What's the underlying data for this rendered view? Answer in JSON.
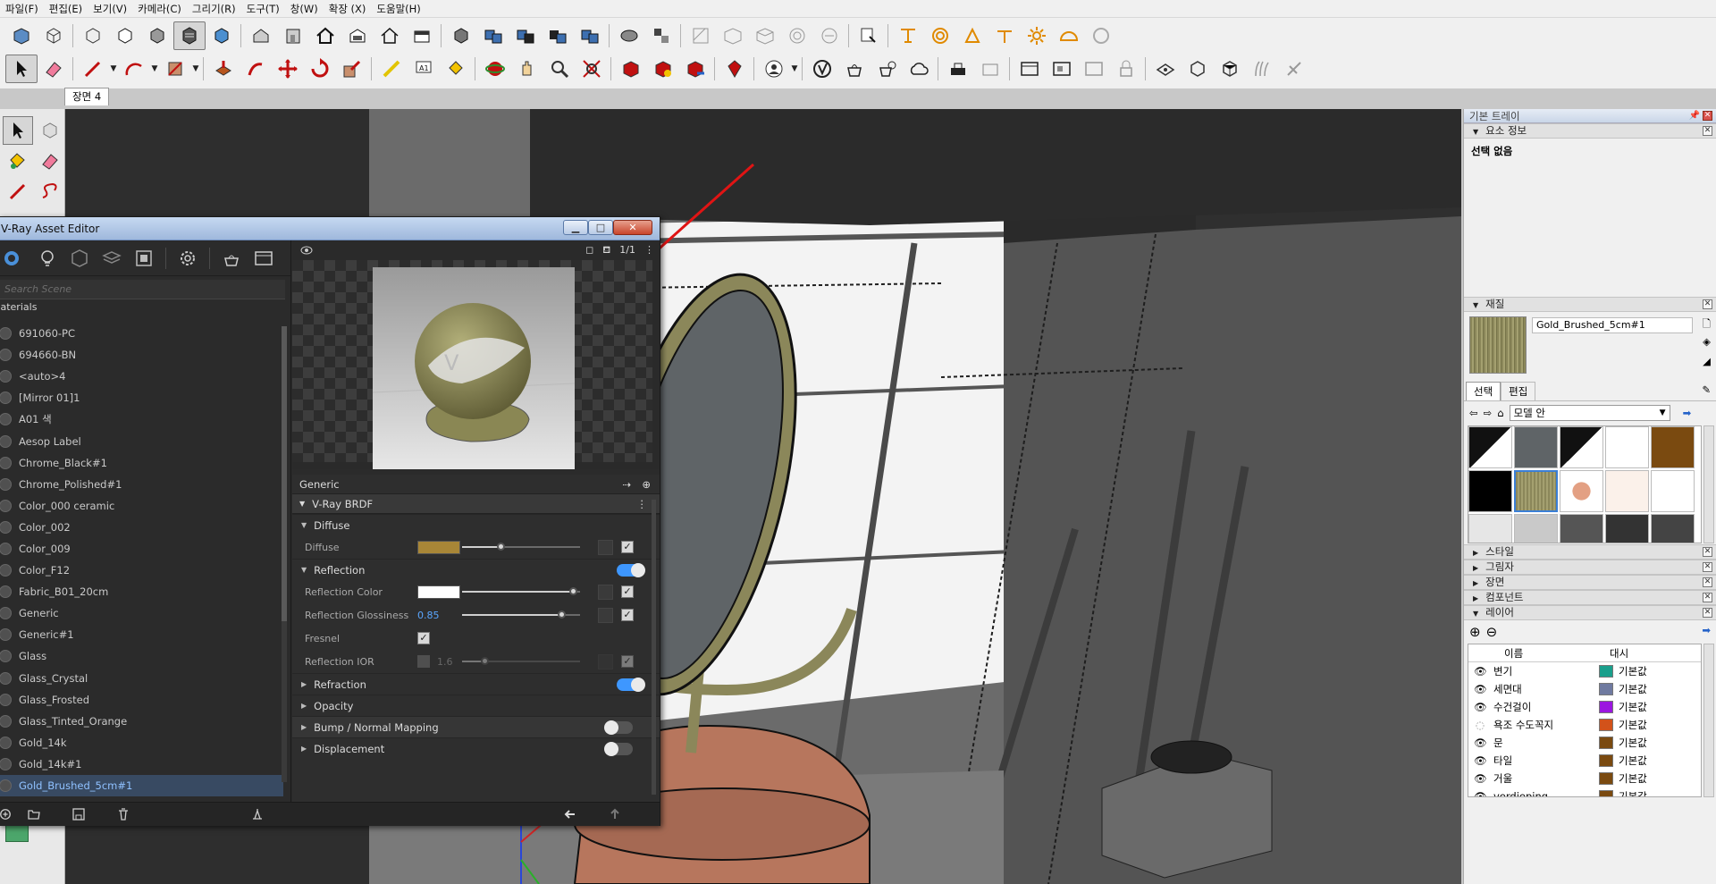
{
  "menubar": {
    "items": [
      "파일(F)",
      "편집(E)",
      "보기(V)",
      "카메라(C)",
      "그리기(R)",
      "도구(T)",
      "창(W)",
      "확장 (X)",
      "도움말(H)"
    ]
  },
  "scene_tabs": [
    "장면 4"
  ],
  "vray_editor": {
    "title": "V-Ray Asset Editor",
    "search_placeholder": "Search Scene",
    "materials_header": "Materials",
    "materials": [
      "691060-PC",
      "694660-BN",
      "<auto>4",
      "[Mirror 01]1",
      "A01 색",
      "Aesop Label",
      "Chrome_Black#1",
      "Chrome_Polished#1",
      "Color_000 ceramic",
      "Color_002",
      "Color_009",
      "Color_F12",
      "Fabric_B01_20cm",
      "Generic",
      "Generic#1",
      "Glass",
      "Glass_Crystal",
      "Glass_Frosted",
      "Glass_Tinted_Orange",
      "Gold_14k",
      "Gold_14k#1",
      "Gold_Brushed_5cm#1"
    ],
    "selected_material": "Gold_Brushed_5cm#1",
    "preview_page": "1/1",
    "props": {
      "generic_label": "Generic",
      "brdf_label": "V-Ray BRDF",
      "diffuse_section": "Diffuse",
      "diffuse_label": "Diffuse",
      "diffuse_color": "#a88637",
      "reflection_section": "Reflection",
      "reflection_color_label": "Reflection Color",
      "reflection_color": "#ffffff",
      "reflection_glossiness_label": "Reflection Glossiness",
      "reflection_glossiness_value": "0.85",
      "fresnel_label": "Fresnel",
      "reflection_ior_label": "Reflection IOR",
      "reflection_ior_value": "1.6",
      "refraction_section": "Refraction",
      "opacity_section": "Opacity",
      "bump_section": "Bump / Normal Mapping",
      "displacement_section": "Displacement"
    },
    "slider_values": {
      "diffuse": 0.33,
      "reflection_color": 0.95,
      "reflection_glossiness": 0.85,
      "reflection_ior": 0.2
    }
  },
  "tray": {
    "title": "기본 트레이",
    "entity_info": {
      "header": "요소 정보",
      "selection": "선택 없음"
    },
    "materials": {
      "header": "재질",
      "current_name": "Gold_Brushed_5cm#1",
      "tab_select": "선택",
      "tab_edit": "편집",
      "library": "모델 안"
    },
    "collapsed_panels": [
      "스타일",
      "그림자",
      "장면",
      "컴포넌트"
    ],
    "layers": {
      "header": "레이어",
      "col_name": "이름",
      "col_dash": "대시",
      "rows": [
        {
          "name": "변기",
          "color": "#1a9f8c",
          "dash": "기본값",
          "visible": true
        },
        {
          "name": "세면대",
          "color": "#6f7aa0",
          "dash": "기본값",
          "visible": true
        },
        {
          "name": "수건걸이",
          "color": "#9b16e0",
          "dash": "기본값",
          "visible": true
        },
        {
          "name": "욕조 수도꼭지",
          "color": "#d2521a",
          "dash": "기본값",
          "visible": false
        },
        {
          "name": "문",
          "color": "#7a4a10",
          "dash": "기본값",
          "visible": true
        },
        {
          "name": "타일",
          "color": "#7a4a10",
          "dash": "기본값",
          "visible": true
        },
        {
          "name": "거울",
          "color": "#7a4a10",
          "dash": "기본값",
          "visible": true
        },
        {
          "name": "verdieping",
          "color": "#7a4a10",
          "dash": "기본값",
          "visible": true
        }
      ]
    }
  },
  "colors": {
    "accent": "#3e97ff",
    "vray_bg": "#2b2b2b",
    "selection": "#384a62"
  }
}
